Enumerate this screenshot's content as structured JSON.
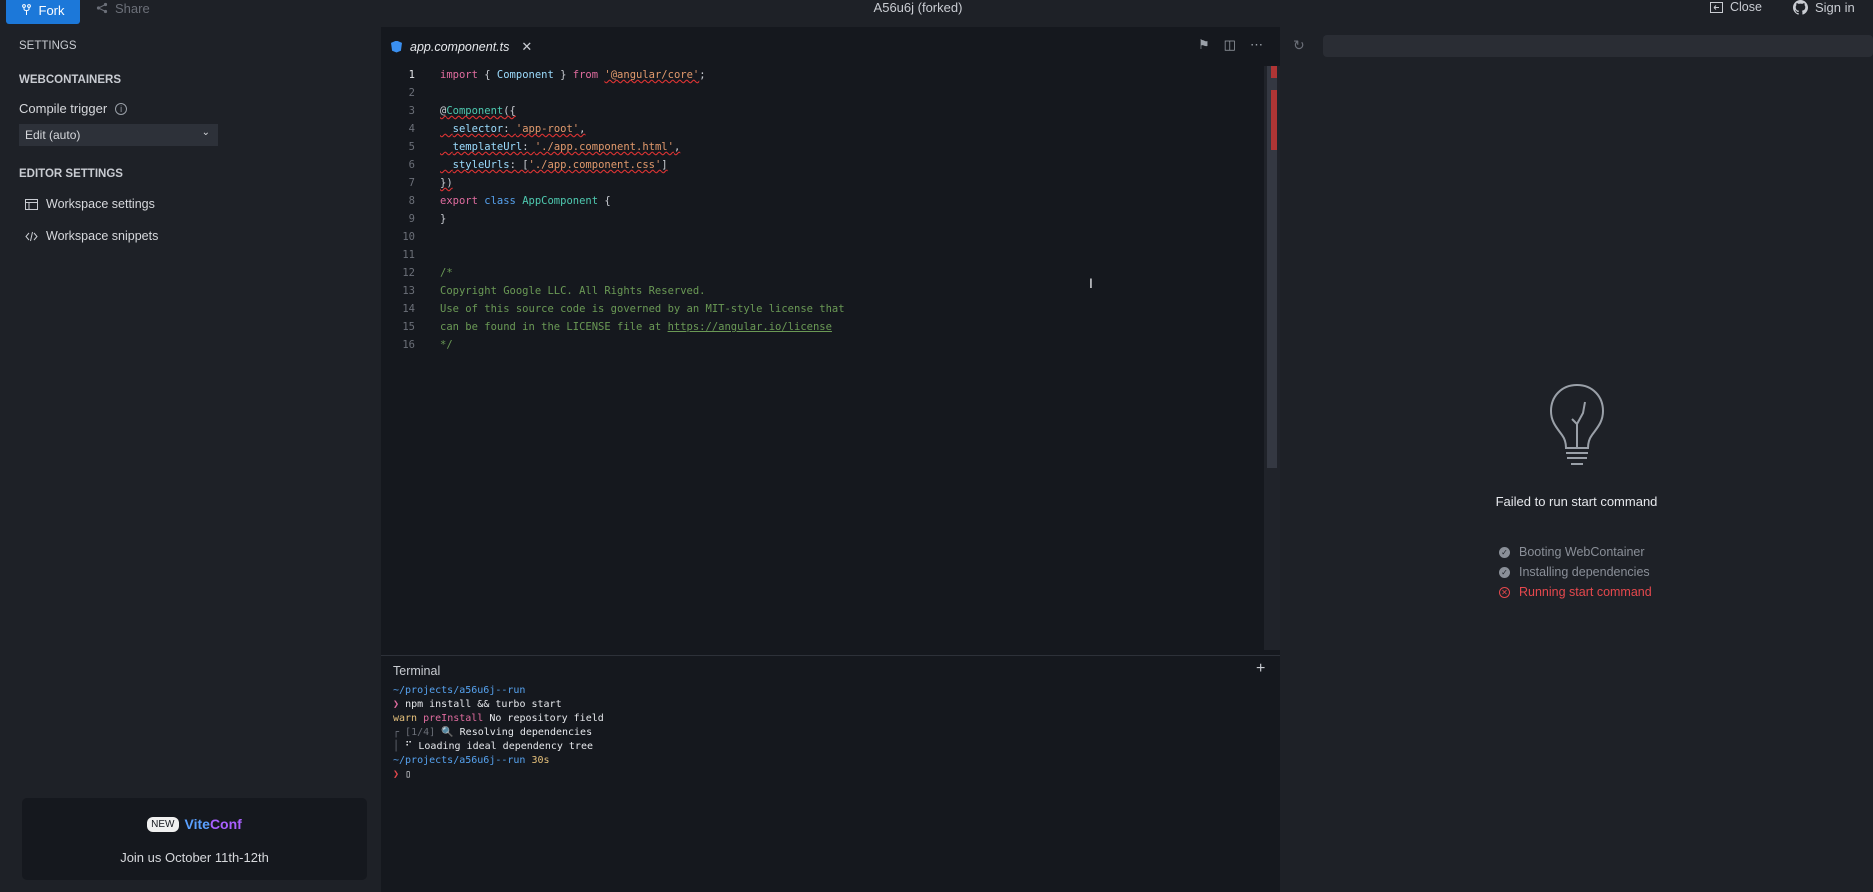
{
  "topbar": {
    "fork_label": "Fork",
    "share_label": "Share",
    "project_title": "A56u6j (forked)",
    "close_label": "Close",
    "signin_label": "Sign in"
  },
  "sidebar": {
    "settings_heading": "SETTINGS",
    "webcontainers_heading": "WEBCONTAINERS",
    "compile_trigger_label": "Compile trigger",
    "compile_trigger_value": "Edit (auto)",
    "editor_settings_heading": "EDITOR SETTINGS",
    "links": [
      {
        "label": "Workspace settings",
        "icon": "settings-grid-icon"
      },
      {
        "label": "Workspace snippets",
        "icon": "code-icon"
      }
    ],
    "promo": {
      "badge": "NEW",
      "brand_vite": "Vite",
      "brand_conf": "Conf",
      "text": "Join us October 11th-12th"
    }
  },
  "editor": {
    "tab_label": "app.component.ts",
    "line_numbers": [
      "1",
      "2",
      "3",
      "4",
      "5",
      "6",
      "7",
      "8",
      "9",
      "10",
      "11",
      "12",
      "13",
      "14",
      "15",
      "16"
    ],
    "active_line": 1
  },
  "terminal": {
    "title": "Terminal",
    "lines": {
      "path1": "~/projects/a56u6j--run",
      "cmd": "npm install && turbo start",
      "warn_word": "warn",
      "warn_tag": "preInstall",
      "warn_msg": " No repository field",
      "step_prefix": "[1/4]",
      "step_msg": " 🔍 Resolving dependencies",
      "loading": "⠋ Loading ideal dependency tree",
      "path2": "~/projects/a56u6j--run",
      "time": "30s"
    }
  },
  "preview": {
    "fail_message": "Failed to run start command",
    "steps": [
      {
        "label": "Booting WebContainer",
        "status": "done"
      },
      {
        "label": "Installing dependencies",
        "status": "done"
      },
      {
        "label": "Running start command",
        "status": "error"
      }
    ],
    "colors": {
      "error": "#e5484d",
      "accent": "#1c78d9"
    }
  }
}
